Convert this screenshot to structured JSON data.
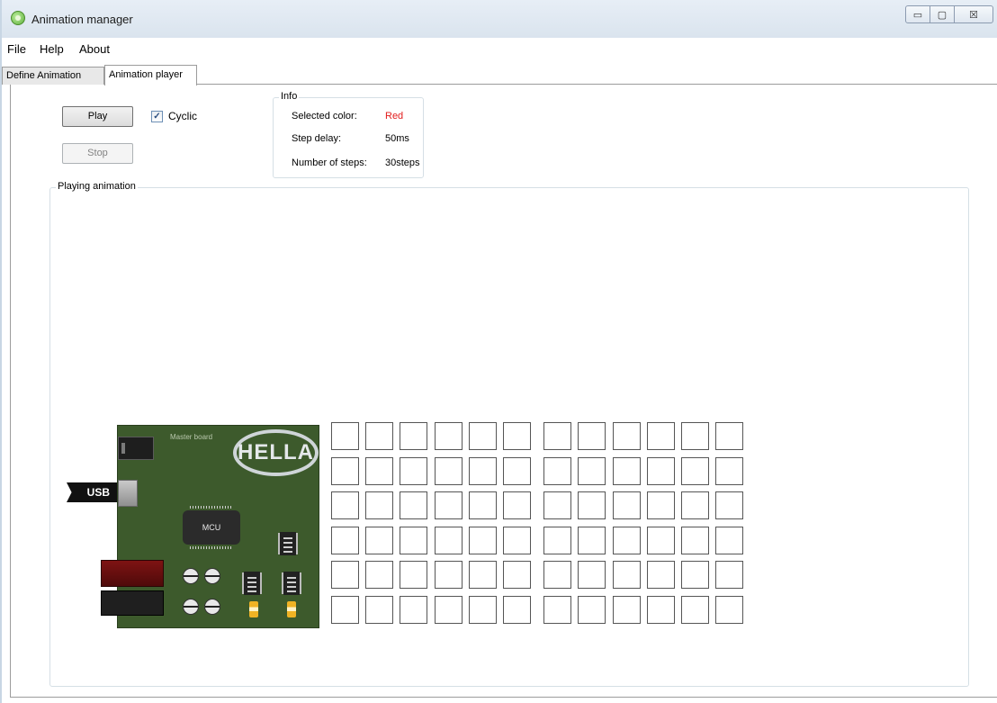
{
  "window": {
    "title": "Animation manager",
    "controls": {
      "minimize": "▭",
      "maximize": "▢",
      "close": "☒"
    }
  },
  "menu": {
    "items": [
      "File",
      "Help",
      "About"
    ]
  },
  "tabs": [
    {
      "label": "Define Animation",
      "active": false
    },
    {
      "label": "Animation player",
      "active": true
    }
  ],
  "player": {
    "play_label": "Play",
    "stop_label": "Stop",
    "stop_enabled": false,
    "cyclic_label": "Cyclic",
    "cyclic_checked": true
  },
  "info": {
    "legend": "Info",
    "rows": [
      {
        "label": "Selected color:",
        "value": "Red",
        "value_color": "#e21b1b"
      },
      {
        "label": "Step delay:",
        "value": "50ms"
      },
      {
        "label": "Number of steps:",
        "value": "30steps"
      }
    ]
  },
  "playing": {
    "legend": "Playing animation",
    "board": {
      "title": "Master board",
      "logo": "HELLA",
      "usb_label": "USB",
      "mcu_label": "MCU"
    },
    "led_grid": {
      "rows": 6,
      "cols": 12,
      "lit": []
    }
  },
  "colors": {
    "accent_red": "#e21b1b",
    "board_green": "#3d5a2c"
  }
}
